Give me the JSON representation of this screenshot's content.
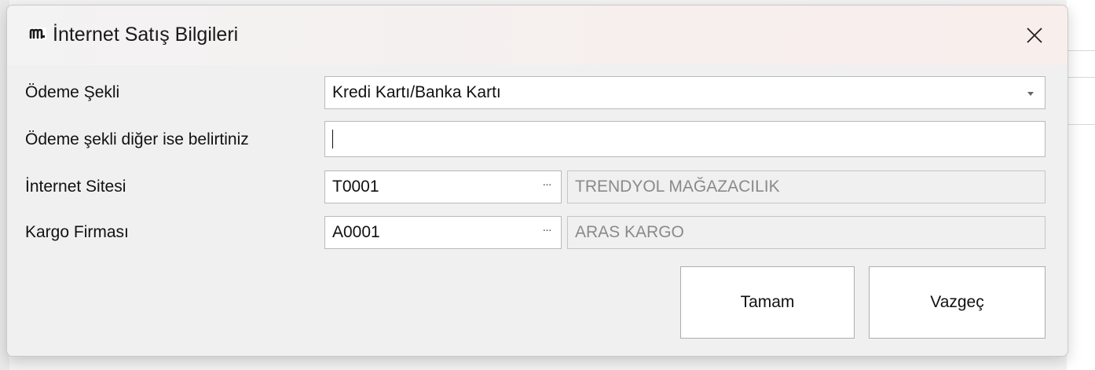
{
  "dialog": {
    "title": "İnternet Satış Bilgileri",
    "app_icon": "logo-m-icon",
    "close_icon": "close-icon"
  },
  "form": {
    "payment_method": {
      "label": "Ödeme Şekli",
      "value": "Kredi Kartı/Banka Kartı"
    },
    "payment_other": {
      "label": "Ödeme şekli diğer ise belirtiniz",
      "value": ""
    },
    "website": {
      "label": "İnternet Sitesi",
      "code": "T0001",
      "name": "TRENDYOL MAĞAZACILIK"
    },
    "cargo": {
      "label": "Kargo Firması",
      "code": "A0001",
      "name": "ARAS KARGO"
    },
    "lookup_button_text": "···"
  },
  "buttons": {
    "ok_label": "Tamam",
    "cancel_label": "Vazgeç"
  }
}
